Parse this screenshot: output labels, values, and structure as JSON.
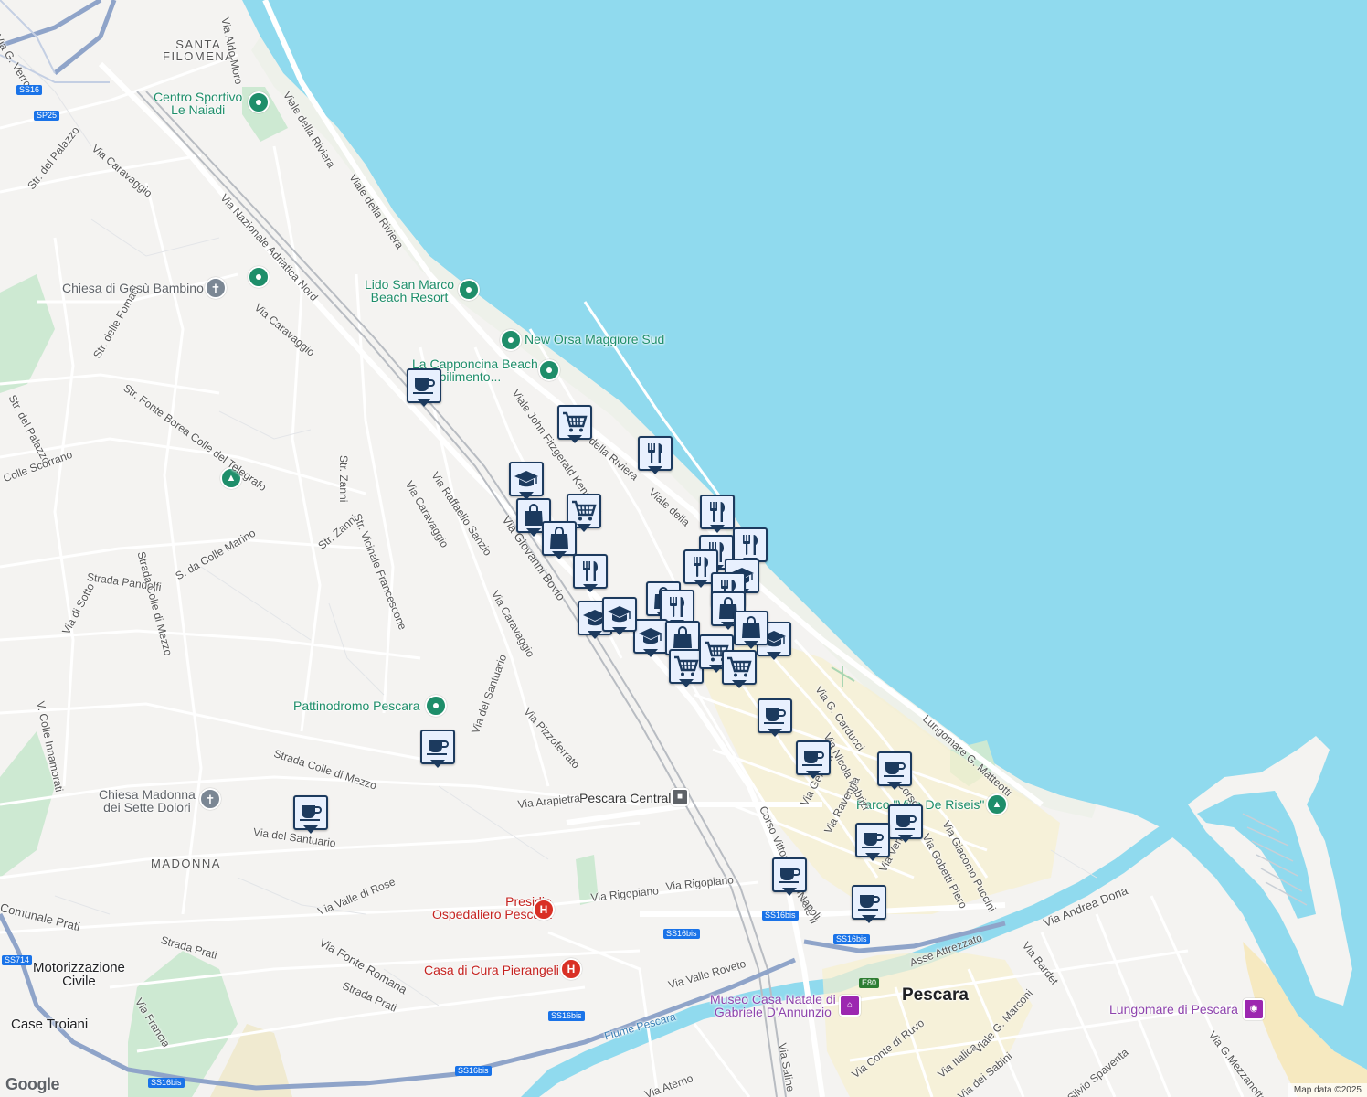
{
  "colors": {
    "sea": "#90daee",
    "land": "#f4f3f1",
    "park": "#cde9d2",
    "highway": "#8fa4c9",
    "road": "#ffffff",
    "marker_fill": "#e8f0fe",
    "marker_border": "#1c3a5e",
    "poi_green": "#1e8e6a",
    "poi_red": "#d93025",
    "poi_purple": "#9c27b0"
  },
  "labels": {
    "santa_filomena": "SANTA\nFILOMENA",
    "madonna": "MADONNA",
    "pescara": "Pescara",
    "motorizzazione": "Motorizzazione\nCivile",
    "case_troiani": "Case Troiani",
    "centro_sportivo": "Centro Sportivo\nLe Naiadi",
    "lido_san_marco": "Lido San Marco\nBeach Resort",
    "new_orsa": "New Orsa Maggiore Sud",
    "capponcina": "La Capponcina Beach\n- Stabilimento...",
    "chiesa_gesu": "Chiesa di Gesù Bambino",
    "pattinodromo": "Pattinodromo Pescara",
    "chiesa_madonna": "Chiesa Madonna\ndei Sette Dolori",
    "pescara_centrale": "Pescara Centrale",
    "presidio": "Presidio\nOspedaliero Pescara",
    "casa_cura": "Casa di Cura Pierangeli",
    "parco_villa": "Parco \"Villa De Riseis\"",
    "museo": "Museo Casa Natale di\nGabriele D'Annunzio",
    "lungomare_pescara": "Lungomare di Pescara"
  },
  "roads": {
    "via_aldo_moro": "Via Aldo Moro",
    "viale_riviera_1": "Viale della Riviera",
    "viale_riviera_2": "Viale della Riviera",
    "viale_riviera_3": "della Riviera",
    "viale_riviera_4": "Viale della",
    "via_verrotti": "Via G. Verrotti",
    "str_del_palazzo_1": "Str. del Palazzo",
    "via_caravaggio_1": "Via Caravaggio",
    "via_nazionale": "Via Nazionale Adriatica Nord",
    "via_caravaggio_2": "Via Caravaggio",
    "str_fomaci": "Str. delle Fomaci",
    "str_del_palazzo_2": "Str. del Palazzo",
    "str_fonte_borea": "Str. Fonte Borea Colle del Telegrafo",
    "colle_scorrano": "Colle Scorrano",
    "str_zanni_1": "Str. Zanni",
    "str_zanni_2": "Str. Zanni",
    "str_vicinale": "Str. Vicinale Francescone",
    "via_caravaggio_3": "Via Caravaggio",
    "via_raffaello": "Via Raffaello Sanzio",
    "viale_kennedy": "Viale John Fitzgerald Kennedy",
    "via_bovio": "Via Giovanni Bovio",
    "s_colle_marino": "S. da Colle Marino",
    "strada_pandolfi": "Strada Pandolfi",
    "strada_colle_mezzo_1": "Strada Colle di Mezzo",
    "via_di_sotto": "Via di Sotto",
    "via_caravaggio_4": "Via Caravaggio",
    "v_colle_innamorati": "V. Colle Innamorati",
    "via_santuario_1": "Via del Santuario",
    "via_pizzoferrato": "Via Pizzoferrato",
    "strada_colle_mezzo_2": "Strada Colle di Mezzo",
    "via_arapietra": "Via Arapietra",
    "via_santuario_2": "Via del Santuario",
    "via_carducci": "Via G. Carducci",
    "via_fabrizi": "Via Nicola Fabrizi",
    "lungomare_matteotti": "Lungomare G. Matteotti",
    "via_genova": "Via Genova",
    "via_ravenna": "Via Ravenna",
    "corso_vittorio": "Corso Vittorio Emanuele II",
    "via_venezia": "Via Venezia",
    "via_gobetti": "Via Gobetti Piero",
    "via_puccini": "Via Giacomo Puccini",
    "via_napoli": "Napoli",
    "via_rigopiano_1": "Via Rigopiano",
    "via_rigopiano_2": "Via Rigopiano",
    "via_valle_rose": "Via Valle di Rose",
    "comunale_prati": "Comunale Prati",
    "strada_prati_1": "Strada Prati",
    "via_fonte_romana": "Via Fonte Romana",
    "strada_prati_2": "Strada Prati",
    "via_francia": "Via Francia",
    "via_valle_roveto": "Via Valle Roveto",
    "fiume_pescara": "Fiume Pescara",
    "via_aterno": "Via Aterno",
    "via_saline": "Via Saline",
    "via_conte_ruvo": "Via Conte di Ruvo",
    "via_italica": "Via Italica",
    "viale_marconi": "Viale G. Marconi",
    "via_sabini": "Via dei Sabini",
    "silvio_spaventa": "Silvio Spaventa",
    "via_mezzanotte": "Via G.Mezzanotte",
    "via_bardet": "Via Bardet",
    "via_andrea_doria": "Via Andrea Doria",
    "asse_attrezzato": "Asse Attrezzato",
    "via_corso": "Corso"
  },
  "shields": {
    "ss16_top": "SS16",
    "sp25": "SP25",
    "ss16bis_a": "SS16bis",
    "ss16bis_b": "SS16bis",
    "ss16bis_c": "SS16bis",
    "ss16bis_d": "SS16bis",
    "ss16bis_e": "SS16bis",
    "ss16bis_f": "SS16bis",
    "ss714": "SS714",
    "e80": "E80"
  },
  "markers": [
    {
      "icon": "cafe",
      "label": "cafe-icon"
    },
    {
      "icon": "cart",
      "label": "cart-icon"
    },
    {
      "icon": "restaurant",
      "label": "restaurant-icon"
    },
    {
      "icon": "school",
      "label": "school-icon"
    },
    {
      "icon": "shop",
      "label": "shopping-bag-icon"
    },
    {
      "icon": "cart",
      "label": "cart-icon"
    },
    {
      "icon": "shop",
      "label": "shopping-bag-icon"
    },
    {
      "icon": "restaurant",
      "label": "restaurant-icon"
    },
    {
      "icon": "restaurant",
      "label": "restaurant-icon"
    },
    {
      "icon": "restaurant",
      "label": "restaurant-icon"
    },
    {
      "icon": "restaurant",
      "label": "restaurant-icon"
    },
    {
      "icon": "school",
      "label": "school-icon"
    },
    {
      "icon": "restaurant",
      "label": "restaurant-icon"
    },
    {
      "icon": "shop",
      "label": "shopping-bag-icon"
    },
    {
      "icon": "restaurant",
      "label": "restaurant-icon"
    },
    {
      "icon": "school",
      "label": "school-icon"
    },
    {
      "icon": "school",
      "label": "school-icon"
    },
    {
      "icon": "school",
      "label": "school-icon"
    },
    {
      "icon": "restaurant",
      "label": "restaurant-icon"
    },
    {
      "icon": "shop",
      "label": "shopping-bag-icon"
    },
    {
      "icon": "shop",
      "label": "shopping-bag-icon"
    },
    {
      "icon": "shop",
      "label": "shopping-bag-icon"
    },
    {
      "icon": "school",
      "label": "school-icon"
    },
    {
      "icon": "cart",
      "label": "cart-icon"
    },
    {
      "icon": "cart",
      "label": "cart-icon"
    },
    {
      "icon": "cart",
      "label": "cart-icon"
    },
    {
      "icon": "cafe",
      "label": "cafe-icon"
    },
    {
      "icon": "cafe",
      "label": "cafe-icon"
    },
    {
      "icon": "cafe",
      "label": "cafe-icon"
    },
    {
      "icon": "cafe",
      "label": "cafe-icon"
    },
    {
      "icon": "cafe",
      "label": "cafe-icon"
    },
    {
      "icon": "cafe",
      "label": "cafe-icon"
    },
    {
      "icon": "cafe",
      "label": "cafe-icon"
    },
    {
      "icon": "cafe",
      "label": "cafe-icon"
    },
    {
      "icon": "cafe",
      "label": "cafe-icon"
    }
  ],
  "footer": {
    "google": "Google",
    "attribution": "Map data ©2025"
  }
}
